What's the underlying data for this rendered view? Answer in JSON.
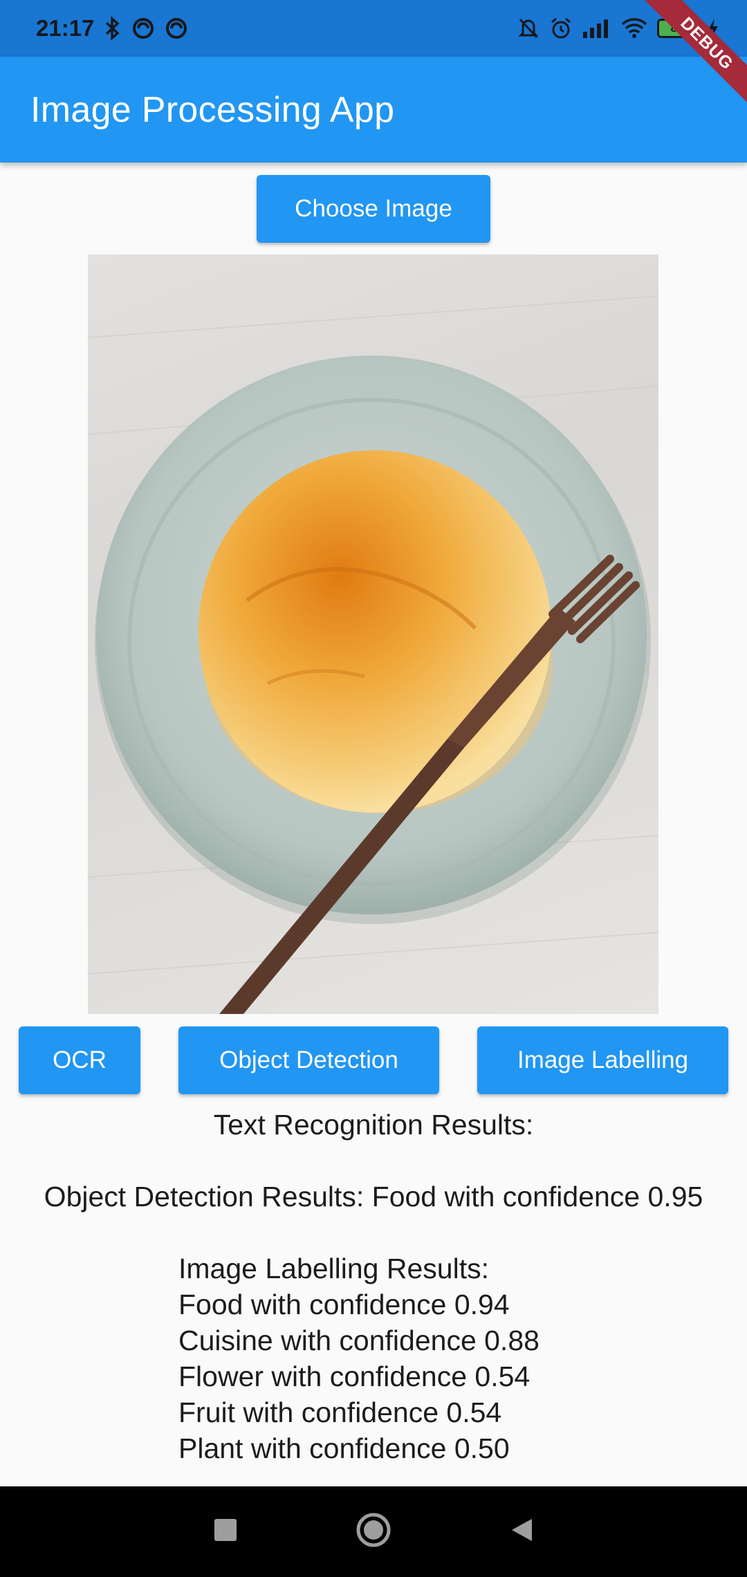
{
  "status_bar": {
    "time": "21:17",
    "battery_level": "83",
    "icons": [
      "bluetooth-icon",
      "vpn-icon",
      "sync-icon",
      "mute-icon",
      "alarm-icon",
      "signal-icon",
      "wifi-icon",
      "battery-icon",
      "charging-icon"
    ]
  },
  "debug_banner": "DEBUG",
  "app_bar": {
    "title": "Image Processing App"
  },
  "choose_image_label": "Choose Image",
  "actions": {
    "ocr": "OCR",
    "object_detection": "Object Detection",
    "image_labelling": "Image Labelling"
  },
  "results": {
    "text_recognition": "Text Recognition Results:",
    "object_detection": "Object Detection Results: Food with confidence 0.95",
    "labelling_header": "Image Labelling Results:",
    "labels": [
      "Food with confidence 0.94",
      "Cuisine with confidence 0.88",
      "Flower with confidence 0.54",
      "Fruit with confidence 0.54",
      "Plant with confidence 0.50"
    ]
  },
  "colors": {
    "primary": "#2196f3",
    "status_bar": "#1976d2",
    "background": "#fafafa",
    "text": "#1c1c1c"
  }
}
